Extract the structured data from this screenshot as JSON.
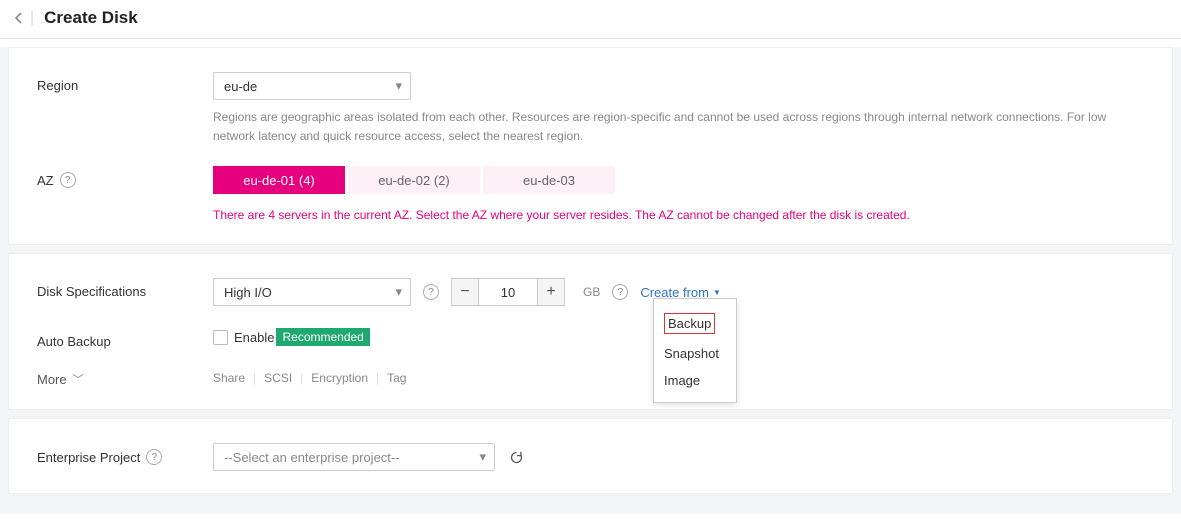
{
  "header": {
    "title": "Create Disk"
  },
  "region": {
    "label": "Region",
    "value": "eu-de",
    "hint": "Regions are geographic areas isolated from each other. Resources are region-specific and cannot be used across regions through internal network connections. For low network latency and quick resource access, select the nearest region."
  },
  "az": {
    "label": "AZ",
    "options": [
      "eu-de-01 (4)",
      "eu-de-02 (2)",
      "eu-de-03"
    ],
    "note": "There are 4 servers in the current AZ. Select the AZ where your server resides. The AZ cannot be changed after the disk is created."
  },
  "spec": {
    "label": "Disk Specifications",
    "type": "High I/O",
    "size": "10",
    "unit": "GB",
    "create_from_label": "Create from",
    "menu": [
      "Backup",
      "Snapshot",
      "Image"
    ]
  },
  "autoBackup": {
    "label": "Auto Backup",
    "enable": "Enable",
    "badge": "Recommended"
  },
  "more": {
    "label": "More",
    "tags": [
      "Share",
      "SCSI",
      "Encryption",
      "Tag"
    ]
  },
  "ep": {
    "label": "Enterprise Project",
    "placeholder": "--Select an enterprise project--"
  }
}
